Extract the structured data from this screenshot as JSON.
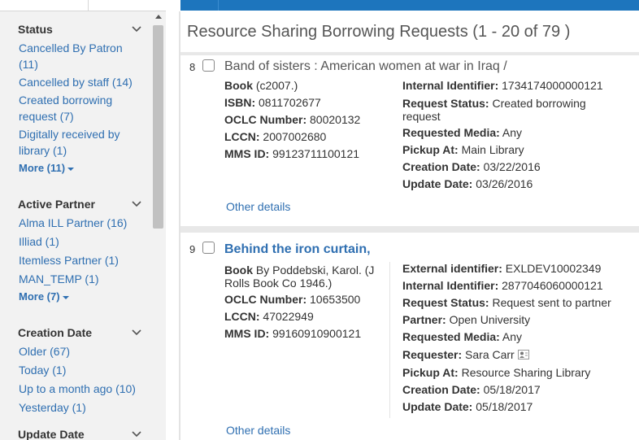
{
  "sidebar": {
    "facets": [
      {
        "title": "Status",
        "items": [
          "Cancelled By Patron (11)",
          "Cancelled by staff (14)",
          "Created borrowing request (7)",
          "Digitally received by library (1)"
        ],
        "more": "More (11)"
      },
      {
        "title": "Active Partner",
        "items": [
          "Alma ILL Partner (16)",
          "Illiad (1)",
          "Itemless Partner (1)",
          "MAN_TEMP (1)"
        ],
        "more": "More (7)"
      },
      {
        "title": "Creation Date",
        "items": [
          "Older (67)",
          "Today (1)",
          "Up to a month ago (10)",
          "Yesterday (1)"
        ]
      },
      {
        "title": "Update Date"
      }
    ]
  },
  "main": {
    "title": "Resource Sharing Borrowing Requests (1 - 20 of 79 )",
    "records": [
      {
        "number": "8",
        "title": "Band of sisters : American women at war in Iraq /",
        "left": [
          {
            "label": "Book",
            "value": " (c2007.)"
          },
          {
            "label": "ISBN:",
            "value": " 0811702677"
          },
          {
            "label": "OCLC Number:",
            "value": " 80020132"
          },
          {
            "label": "LCCN:",
            "value": " 2007002680"
          },
          {
            "label": "MMS ID:",
            "value": " 99123711100121"
          }
        ],
        "right": [
          {
            "label": "Internal Identifier:",
            "value": " 1734174000000121"
          },
          {
            "label": "Request Status:",
            "value": " Created borrowing",
            "value2": "request"
          },
          {
            "label": "Requested Media:",
            "value": " Any"
          },
          {
            "label": "Pickup At:",
            "value": " Main Library"
          },
          {
            "label": "Creation Date:",
            "value": " 03/22/2016"
          },
          {
            "label": "Update Date:",
            "value": " 03/26/2016"
          }
        ],
        "other_details": "Other details"
      },
      {
        "number": "9",
        "title": "Behind the iron curtain,",
        "left": [
          {
            "label": "Book",
            "value": " By Poddebski, Karol. (J",
            "value2": "Rolls Book Co 1946.)"
          },
          {
            "label": "OCLC Number:",
            "value": " 10653500"
          },
          {
            "label": "LCCN:",
            "value": " 47022949"
          },
          {
            "label": "MMS ID:",
            "value": " 99160910900121"
          }
        ],
        "right": [
          {
            "label": "External identifier:",
            "value": " EXLDEV10002349"
          },
          {
            "label": "Internal Identifier:",
            "value": " 2877046060000121"
          },
          {
            "label": "Request Status:",
            "value": " Request sent to partner"
          },
          {
            "label": "Partner:",
            "value": " Open University"
          },
          {
            "label": "Requested Media:",
            "value": " Any"
          },
          {
            "label": "Requester:",
            "value": " Sara Carr"
          },
          {
            "label": "Pickup At:",
            "value": " Resource Sharing Library"
          },
          {
            "label": "Creation Date:",
            "value": " 05/18/2017"
          },
          {
            "label": "Update Date:",
            "value": " 05/18/2017"
          }
        ],
        "other_details": "Other details"
      }
    ]
  },
  "icons": {
    "chevron": "chevron-down-icon",
    "scroll_up": "scroll-up-arrow-icon",
    "requester": "user-card-icon"
  },
  "colors": {
    "link": "#2f6fb1",
    "topbar": "#1d75bd",
    "sidebar_bg": "#f2f2f2"
  }
}
